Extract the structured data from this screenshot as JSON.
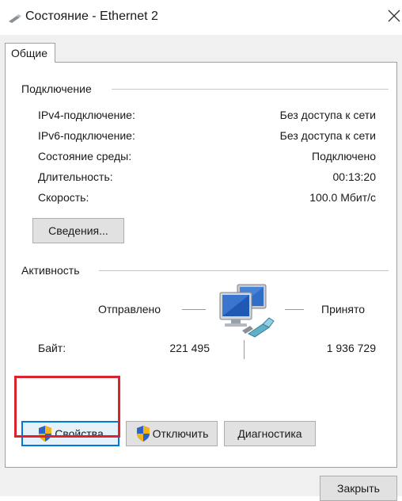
{
  "window": {
    "title": "Состояние - Ethernet 2",
    "close_icon": "close-x-icon",
    "app_icon": "network-adapter-icon"
  },
  "tabs": [
    {
      "label": "Общие",
      "selected": true
    }
  ],
  "connection": {
    "group_label": "Подключение",
    "rows": [
      {
        "label": "IPv4-подключение:",
        "value": "Без доступа к сети"
      },
      {
        "label": "IPv6-подключение:",
        "value": "Без доступа к сети"
      },
      {
        "label": "Состояние среды:",
        "value": "Подключено"
      },
      {
        "label": "Длительность:",
        "value": "00:13:20"
      },
      {
        "label": "Скорость:",
        "value": "100.0 Мбит/с"
      }
    ],
    "details_button": "Сведения..."
  },
  "activity": {
    "group_label": "Активность",
    "sent_label": "Отправлено",
    "received_label": "Принято",
    "bytes_label": "Байт:",
    "bytes_sent": "221 495",
    "bytes_received": "1 936 729",
    "icon": "network-computers-icon"
  },
  "buttons": {
    "properties": "Свойства",
    "disable": "Отключить",
    "diagnose": "Диагностика",
    "close": "Закрыть"
  },
  "colors": {
    "highlight_box": "#d9232f",
    "focus_border": "#0078d7"
  }
}
